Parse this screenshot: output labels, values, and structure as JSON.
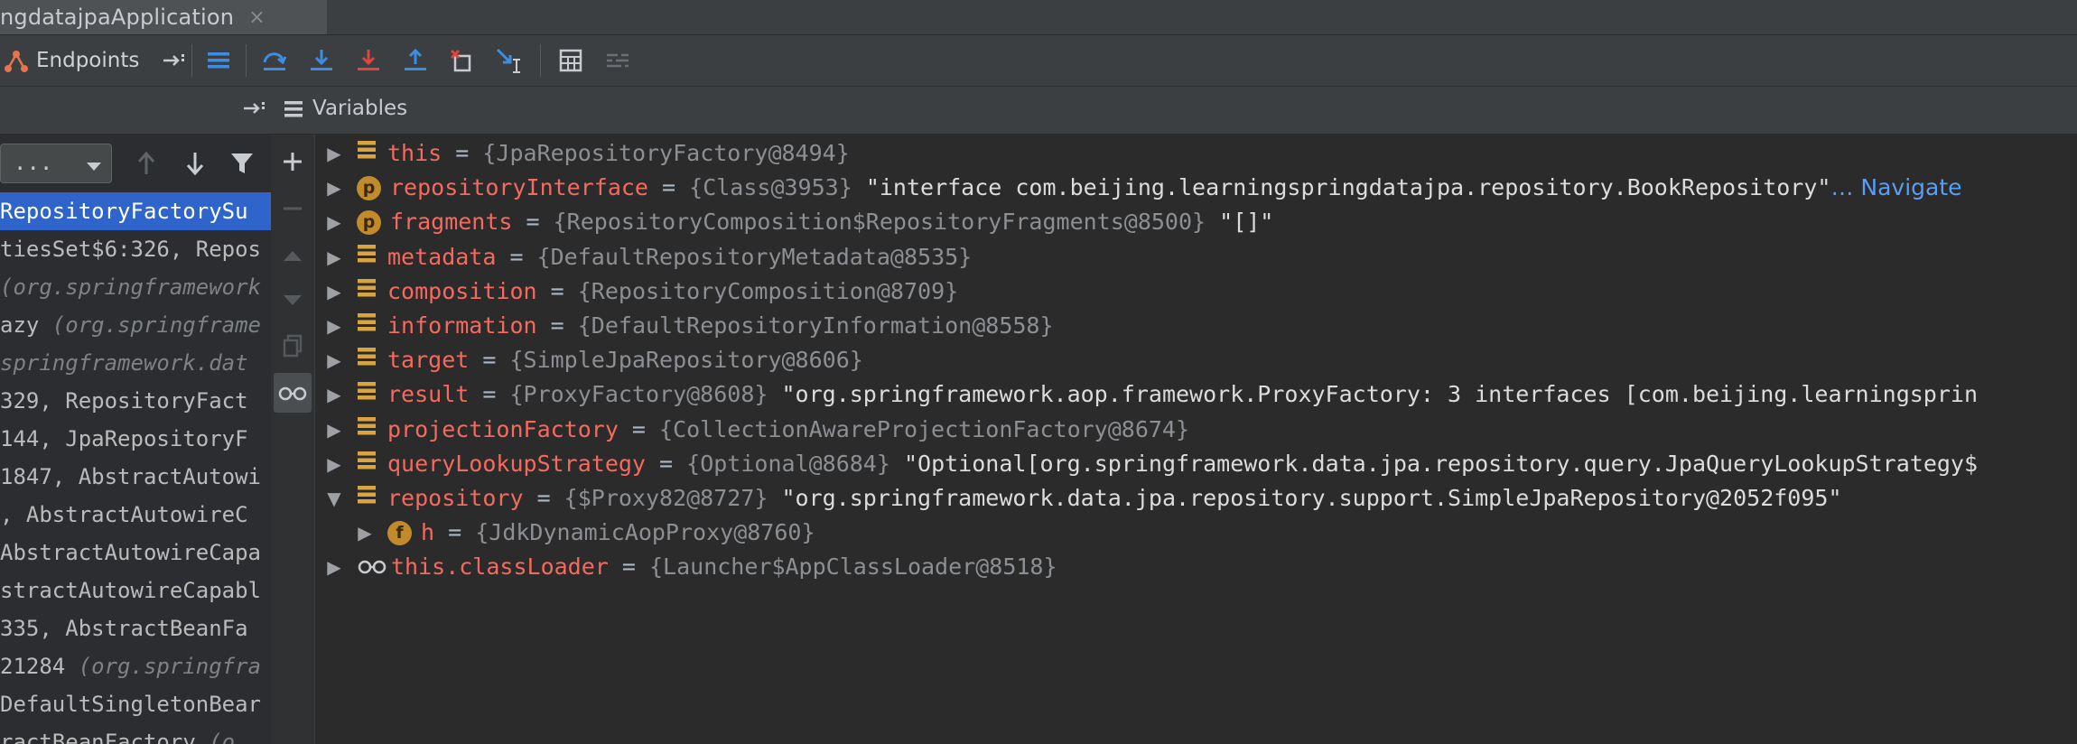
{
  "tab": {
    "title": "ngdatajpaApplication",
    "close_glyph": "×"
  },
  "toolbar": {
    "endpoints_label": "Endpoints",
    "icons": [
      "endpoints-icon",
      "pin-icon",
      "frames-list-icon",
      "step-over-icon",
      "step-into-icon",
      "force-step-into-icon",
      "step-out-icon",
      "drop-frame-icon",
      "run-to-cursor-icon",
      "evaluate-expression-icon",
      "trace-icon"
    ]
  },
  "header": {
    "variables_label": "Variables"
  },
  "frames": {
    "thread_combo_value": "...",
    "rows": [
      {
        "text": "RepositoryFactorySu",
        "style": "sel"
      },
      {
        "text": "tiesSet$6:326, Repos",
        "style": "norm"
      },
      {
        "text": "(org.springframework",
        "style": "lib"
      },
      {
        "text": "azy (org.springframe",
        "style": "mixed",
        "pre": "azy ",
        "post": "(org.springframe"
      },
      {
        "text": "springframework.dat",
        "style": "lib"
      },
      {
        "text": " 329, RepositoryFact",
        "style": "norm"
      },
      {
        "text": " 144, JpaRepositoryF",
        "style": "norm"
      },
      {
        "text": "1847, AbstractAutowi",
        "style": "norm"
      },
      {
        "text": ", AbstractAutowireC",
        "style": "norm"
      },
      {
        "text": "AbstractAutowireCapa",
        "style": "norm"
      },
      {
        "text": "stractAutowireCapabl",
        "style": "norm"
      },
      {
        "text": " 335, AbstractBeanFa",
        "style": "norm"
      },
      {
        "text": "21284 (org.springfra",
        "style": "mixed",
        "pre": "21284 ",
        "post": "(org.springfra"
      },
      {
        "text": "DefaultSingletonBear",
        "style": "norm"
      },
      {
        "text": "ractBeanFactory (o",
        "style": "mixed",
        "pre": "ractBeanFactory ",
        "post": "(o"
      }
    ]
  },
  "variables": [
    {
      "expanded": false,
      "indent": 0,
      "icon": "field",
      "name": "this",
      "type": "{JpaRepositoryFactory@8494}",
      "value": "",
      "link": ""
    },
    {
      "expanded": false,
      "indent": 0,
      "icon": "p",
      "name": "repositoryInterface",
      "type": "{Class@3953}",
      "value": "\"interface com.beijing.learningspringdatajpa.repository.BookRepository\"",
      "link": "… Navigate"
    },
    {
      "expanded": false,
      "indent": 0,
      "icon": "p",
      "name": "fragments",
      "type": "{RepositoryComposition$RepositoryFragments@8500}",
      "value": "\"[]\"",
      "link": ""
    },
    {
      "expanded": false,
      "indent": 0,
      "icon": "field",
      "name": "metadata",
      "type": "{DefaultRepositoryMetadata@8535}",
      "value": "",
      "link": ""
    },
    {
      "expanded": false,
      "indent": 0,
      "icon": "field",
      "name": "composition",
      "type": "{RepositoryComposition@8709}",
      "value": "",
      "link": ""
    },
    {
      "expanded": false,
      "indent": 0,
      "icon": "field",
      "name": "information",
      "type": "{DefaultRepositoryInformation@8558}",
      "value": "",
      "link": ""
    },
    {
      "expanded": false,
      "indent": 0,
      "icon": "field",
      "name": "target",
      "type": "{SimpleJpaRepository@8606}",
      "value": "",
      "link": ""
    },
    {
      "expanded": false,
      "indent": 0,
      "icon": "field",
      "name": "result",
      "type": "{ProxyFactory@8608}",
      "value": "\"org.springframework.aop.framework.ProxyFactory: 3 interfaces [com.beijing.learningsprin",
      "link": ""
    },
    {
      "expanded": false,
      "indent": 0,
      "icon": "field",
      "name": "projectionFactory",
      "type": "{CollectionAwareProjectionFactory@8674}",
      "value": "",
      "link": ""
    },
    {
      "expanded": false,
      "indent": 0,
      "icon": "field",
      "name": "queryLookupStrategy",
      "type": "{Optional@8684}",
      "value": "\"Optional[org.springframework.data.jpa.repository.query.JpaQueryLookupStrategy$",
      "link": ""
    },
    {
      "expanded": true,
      "indent": 0,
      "icon": "field",
      "name": "repository",
      "type": "{$Proxy82@8727}",
      "value": "\"org.springframework.data.jpa.repository.support.SimpleJpaRepository@2052f095\"",
      "link": ""
    },
    {
      "expanded": false,
      "indent": 1,
      "icon": "f",
      "name": "h",
      "type": "{JdkDynamicAopProxy@8760}",
      "value": "",
      "link": ""
    },
    {
      "expanded": false,
      "indent": 0,
      "icon": "watch",
      "name": "this.classLoader",
      "type": "{Launcher$AppClassLoader@8518}",
      "value": "",
      "link": ""
    }
  ],
  "colors": {
    "selection": "#2f65ca",
    "var_name": "#f46a5e",
    "link": "#589df6",
    "badge": "#c08a2d"
  }
}
